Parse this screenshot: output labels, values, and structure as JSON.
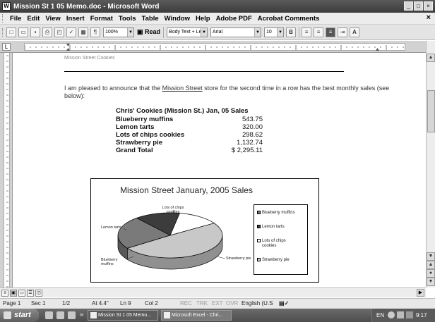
{
  "window": {
    "title": "Mission St 1 05 Memo.doc - Microsoft Word",
    "app_icon": "W"
  },
  "menu": {
    "items": [
      "File",
      "Edit",
      "View",
      "Insert",
      "Format",
      "Tools",
      "Table",
      "Window",
      "Help",
      "Adobe PDF",
      "Acrobat Comments"
    ],
    "close": "×"
  },
  "toolbar": {
    "zoom": "100%",
    "read": "Read",
    "style": "Body Text + Le",
    "font": "Arial",
    "size": "10",
    "bold": "B"
  },
  "document": {
    "heading_partial": "Mission Street Cookies",
    "intro_pre": "I am pleased to announce that the ",
    "intro_link": "Mission Street",
    "intro_post": " store for the second time in a row has the best monthly sales (see below):",
    "table": {
      "header": "Chris' Cookies (Mission St.) Jan, 05 Sales",
      "rows": [
        {
          "label": "Blueberry muffins",
          "value": "543.75"
        },
        {
          "label": "Lemon tarts",
          "value": "320.00"
        },
        {
          "label": "Lots of chips cookies",
          "value": "298.62"
        },
        {
          "label": "Strawberry pie",
          "value": "1,132.74"
        }
      ],
      "total_label": "Grand Total",
      "total_value": "$ 2,295.11"
    }
  },
  "chart_data": {
    "type": "pie",
    "title": "Mission Street January, 2005 Sales",
    "categories": [
      "Blueberry muffins",
      "Lemon tarts",
      "Lots of chips cookies",
      "Strawberry pie"
    ],
    "values": [
      543.75,
      320.0,
      298.62,
      1132.74
    ],
    "slice_labels": [
      "Blueberry muffins",
      "Lemon tarts",
      "Lots of chips cookies",
      "Strawberry pie"
    ],
    "legend": "right",
    "colors": [
      "#7a7a7a",
      "#3c3c3c",
      "#ffffff",
      "#c8c8c8"
    ],
    "three_d": true
  },
  "status": {
    "page": "Page 1",
    "sec": "Sec 1",
    "pages": "1/2",
    "at": "At 4.4\"",
    "ln": "Ln 9",
    "col": "Col 2",
    "rec": "REC",
    "trk": "TRK",
    "ext": "EXT",
    "ovr": "OVR",
    "lang": "English (U.S"
  },
  "taskbar": {
    "start": "start",
    "tasks": [
      "Mission St 1 05 Memo...",
      "Microsoft Excel - Chri..."
    ],
    "tray_lang": "EN",
    "clock": "9:17 PM"
  }
}
